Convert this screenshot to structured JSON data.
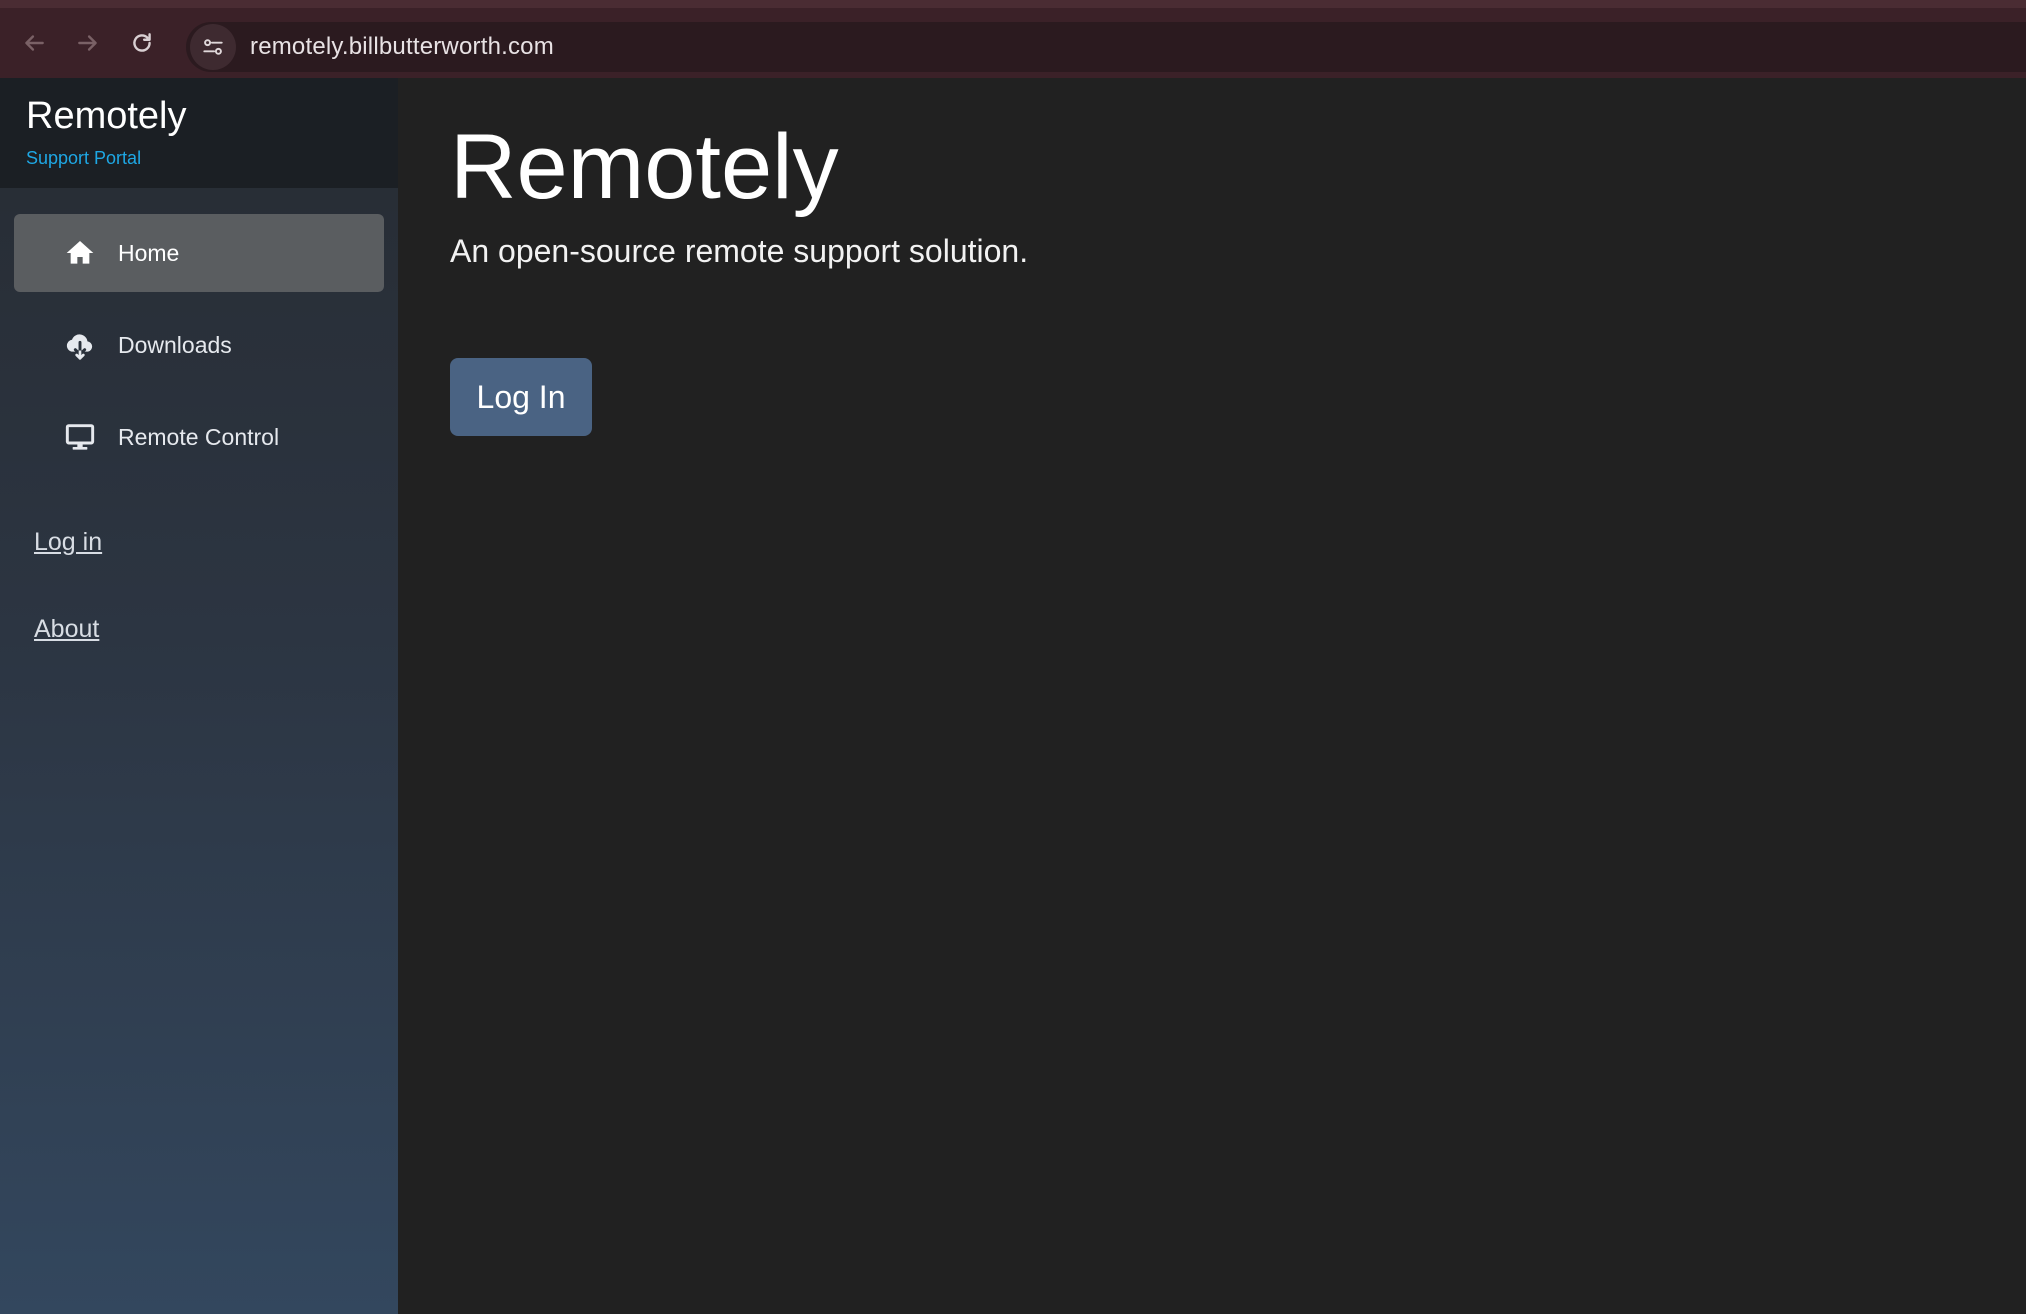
{
  "browser": {
    "url": "remotely.billbutterworth.com",
    "back_icon": "arrow-left-icon",
    "forward_icon": "arrow-right-icon",
    "reload_icon": "reload-icon",
    "site_settings_icon": "site-settings-icon"
  },
  "sidebar": {
    "brand_title": "Remotely",
    "brand_subtitle": "Support Portal",
    "items": [
      {
        "label": "Home",
        "icon": "home-icon",
        "active": true
      },
      {
        "label": "Downloads",
        "icon": "cloud-download-icon",
        "active": false
      },
      {
        "label": "Remote Control",
        "icon": "monitor-icon",
        "active": false
      }
    ],
    "links": [
      {
        "label": "Log in"
      },
      {
        "label": "About"
      }
    ]
  },
  "main": {
    "title": "Remotely",
    "subtitle": "An open-source remote support solution.",
    "login_button": "Log In"
  },
  "colors": {
    "browser_bar": "#3b2128",
    "sidebar_brand_bg": "#1b1f24",
    "brand_subtitle": "#1ea7e4",
    "active_nav": "#5a5d60",
    "main_bg": "#212121",
    "login_button": "#4a6383"
  }
}
